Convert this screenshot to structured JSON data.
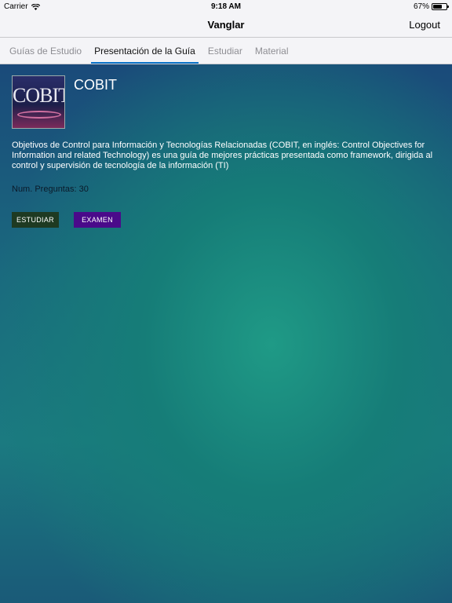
{
  "status": {
    "carrier": "Carrier",
    "time": "9:18 AM",
    "battery": "67%",
    "battery_level": 0.67
  },
  "nav": {
    "title": "Vanglar",
    "logout": "Logout"
  },
  "tabs": [
    {
      "label": "Guías de Estudio",
      "active": false
    },
    {
      "label": "Presentación de la Guía",
      "active": true
    },
    {
      "label": "Estudiar",
      "active": false
    },
    {
      "label": "Material",
      "active": false
    }
  ],
  "guide": {
    "logo_text": "COBIT",
    "title": "COBIT",
    "description": "Objetivos de Control para Información y Tecnologías Relacionadas (COBIT, en inglés: Control Objectives for Information and related Technology) es una guía de mejores prácticas presentada como framework, dirigida al control y supervisión de tecnología de la información (TI)",
    "count": "Num. Preguntas: 30"
  },
  "buttons": {
    "study": "ESTUDIAR",
    "exam": "EXAMEN"
  }
}
